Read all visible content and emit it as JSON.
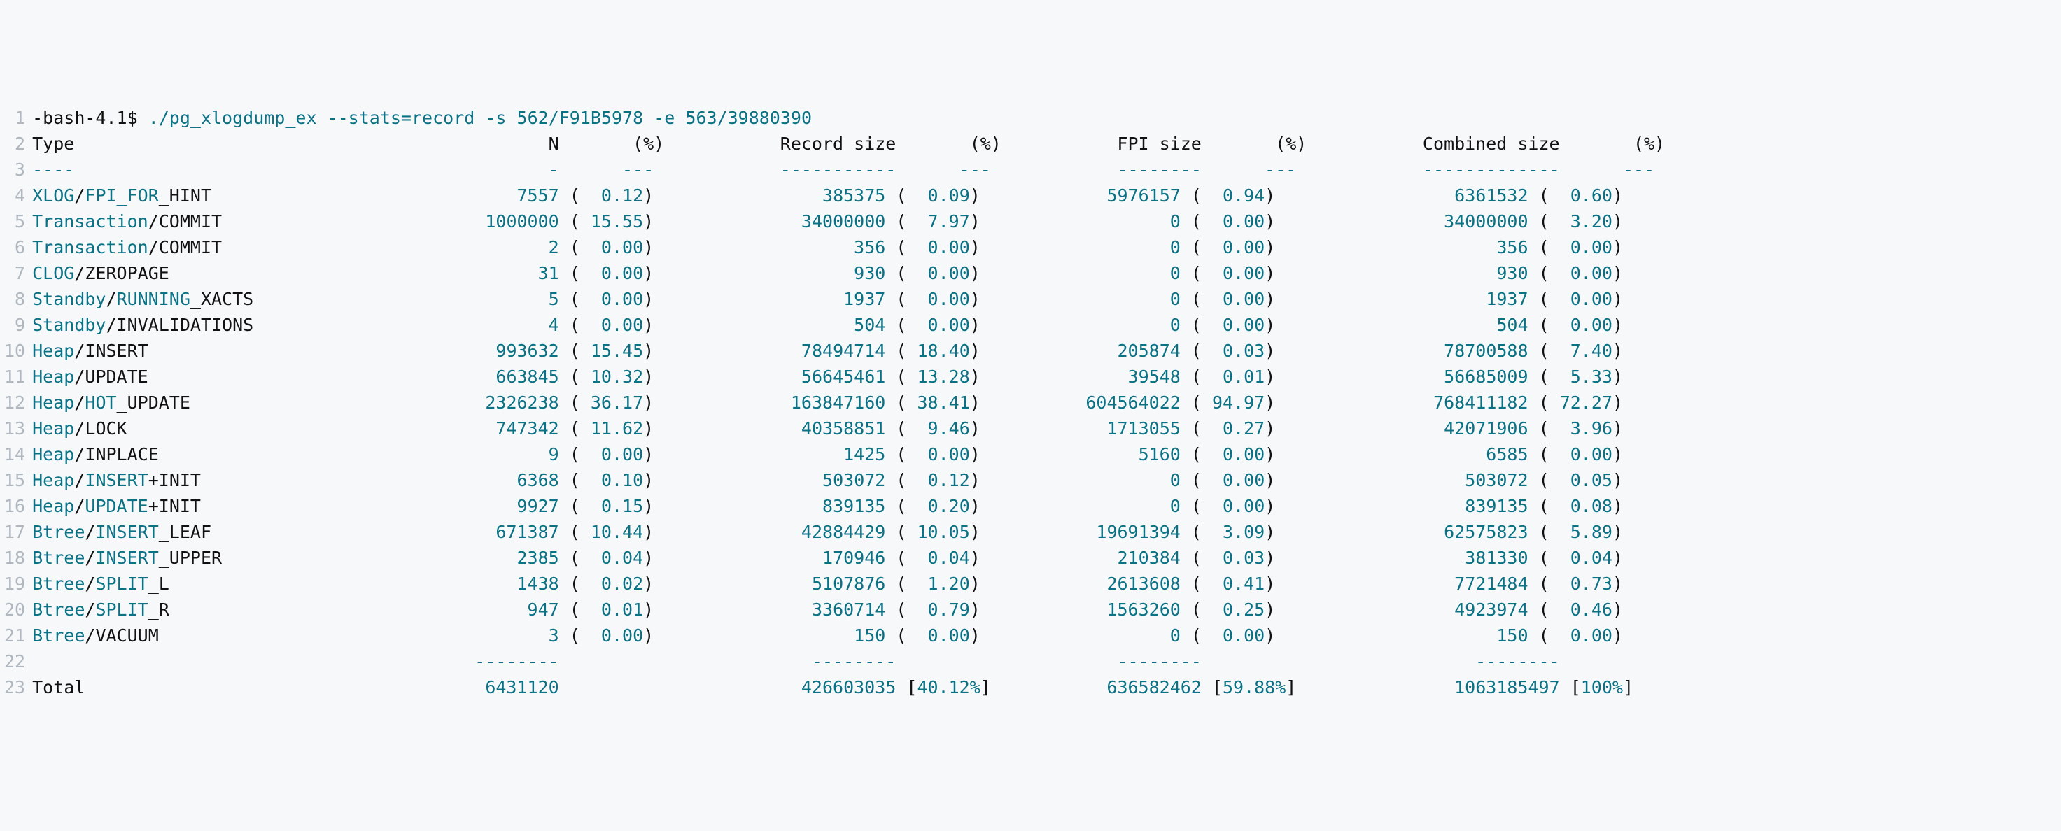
{
  "prompt": "-bash-4.1$ ",
  "cmd": {
    "exe": "./pg_xlogdump_ex",
    "flag_stats": "--stats=record",
    "flag_s": "-s",
    "val_s": "562/F91B5978",
    "flag_e": "-e",
    "val_e": "563/39880390"
  },
  "header": {
    "type": "Type",
    "n": "N",
    "np": "(%)",
    "rs": "Record size",
    "rsp": "(%)",
    "fs": "FPI size",
    "fsp": "(%)",
    "cs": "Combined size",
    "csp": "(%)"
  },
  "sep": {
    "type": "----",
    "n": "-",
    "np": "---",
    "rs": "-----------",
    "rsp": "---",
    "fs": "--------",
    "fsp": "---",
    "cs": "-------------",
    "csp": "---"
  },
  "rows": [
    {
      "a": "XLOG",
      "s": "/",
      "b": "FPI_FOR",
      "c": "_HINT",
      "n": "7557",
      "np": "0.12",
      "rs": "385375",
      "rsp": "0.09",
      "fs": "5976157",
      "fsp": "0.94",
      "cs": "6361532",
      "csp": "0.60"
    },
    {
      "a": "Transaction",
      "s": "/",
      "b": "",
      "c": "COMMIT",
      "n": "1000000",
      "np": "15.55",
      "rs": "34000000",
      "rsp": "7.97",
      "fs": "0",
      "fsp": "0.00",
      "cs": "34000000",
      "csp": "3.20"
    },
    {
      "a": "Transaction",
      "s": "/",
      "b": "",
      "c": "COMMIT",
      "n": "2",
      "np": "0.00",
      "rs": "356",
      "rsp": "0.00",
      "fs": "0",
      "fsp": "0.00",
      "cs": "356",
      "csp": "0.00"
    },
    {
      "a": "CLOG",
      "s": "/",
      "b": "",
      "c": "ZEROPAGE",
      "n": "31",
      "np": "0.00",
      "rs": "930",
      "rsp": "0.00",
      "fs": "0",
      "fsp": "0.00",
      "cs": "930",
      "csp": "0.00"
    },
    {
      "a": "Standby",
      "s": "/",
      "b": "RUNNING",
      "c": "_XACTS",
      "n": "5",
      "np": "0.00",
      "rs": "1937",
      "rsp": "0.00",
      "fs": "0",
      "fsp": "0.00",
      "cs": "1937",
      "csp": "0.00"
    },
    {
      "a": "Standby",
      "s": "/",
      "b": "",
      "c": "INVALIDATIONS",
      "n": "4",
      "np": "0.00",
      "rs": "504",
      "rsp": "0.00",
      "fs": "0",
      "fsp": "0.00",
      "cs": "504",
      "csp": "0.00"
    },
    {
      "a": "Heap",
      "s": "/",
      "b": "",
      "c": "INSERT",
      "n": "993632",
      "np": "15.45",
      "rs": "78494714",
      "rsp": "18.40",
      "fs": "205874",
      "fsp": "0.03",
      "cs": "78700588",
      "csp": "7.40"
    },
    {
      "a": "Heap",
      "s": "/",
      "b": "",
      "c": "UPDATE",
      "n": "663845",
      "np": "10.32",
      "rs": "56645461",
      "rsp": "13.28",
      "fs": "39548",
      "fsp": "0.01",
      "cs": "56685009",
      "csp": "5.33"
    },
    {
      "a": "Heap",
      "s": "/",
      "b": "HOT",
      "c": "_UPDATE",
      "n": "2326238",
      "np": "36.17",
      "rs": "163847160",
      "rsp": "38.41",
      "fs": "604564022",
      "fsp": "94.97",
      "cs": "768411182",
      "csp": "72.27"
    },
    {
      "a": "Heap",
      "s": "/",
      "b": "",
      "c": "LOCK",
      "n": "747342",
      "np": "11.62",
      "rs": "40358851",
      "rsp": "9.46",
      "fs": "1713055",
      "fsp": "0.27",
      "cs": "42071906",
      "csp": "3.96"
    },
    {
      "a": "Heap",
      "s": "/",
      "b": "",
      "c": "INPLACE",
      "n": "9",
      "np": "0.00",
      "rs": "1425",
      "rsp": "0.00",
      "fs": "5160",
      "fsp": "0.00",
      "cs": "6585",
      "csp": "0.00"
    },
    {
      "a": "Heap",
      "s": "/",
      "b": "INSERT",
      "s2": "+",
      "c": "INIT",
      "n": "6368",
      "np": "0.10",
      "rs": "503072",
      "rsp": "0.12",
      "fs": "0",
      "fsp": "0.00",
      "cs": "503072",
      "csp": "0.05"
    },
    {
      "a": "Heap",
      "s": "/",
      "b": "UPDATE",
      "s2": "+",
      "c": "INIT",
      "n": "9927",
      "np": "0.15",
      "rs": "839135",
      "rsp": "0.20",
      "fs": "0",
      "fsp": "0.00",
      "cs": "839135",
      "csp": "0.08"
    },
    {
      "a": "Btree",
      "s": "/",
      "b": "INSERT",
      "c": "_LEAF",
      "n": "671387",
      "np": "10.44",
      "rs": "42884429",
      "rsp": "10.05",
      "fs": "19691394",
      "fsp": "3.09",
      "cs": "62575823",
      "csp": "5.89"
    },
    {
      "a": "Btree",
      "s": "/",
      "b": "INSERT",
      "c": "_UPPER",
      "n": "2385",
      "np": "0.04",
      "rs": "170946",
      "rsp": "0.04",
      "fs": "210384",
      "fsp": "0.03",
      "cs": "381330",
      "csp": "0.04"
    },
    {
      "a": "Btree",
      "s": "/",
      "b": "SPLIT",
      "c": "_L",
      "n": "1438",
      "np": "0.02",
      "rs": "5107876",
      "rsp": "1.20",
      "fs": "2613608",
      "fsp": "0.41",
      "cs": "7721484",
      "csp": "0.73"
    },
    {
      "a": "Btree",
      "s": "/",
      "b": "SPLIT",
      "c": "_R",
      "n": "947",
      "np": "0.01",
      "rs": "3360714",
      "rsp": "0.79",
      "fs": "1563260",
      "fsp": "0.25",
      "cs": "4923974",
      "csp": "0.46"
    },
    {
      "a": "Btree",
      "s": "/",
      "b": "",
      "c": "VACUUM",
      "n": "3",
      "np": "0.00",
      "rs": "150",
      "rsp": "0.00",
      "fs": "0",
      "fsp": "0.00",
      "cs": "150",
      "csp": "0.00"
    }
  ],
  "totsep": "--------",
  "total": {
    "label": "Total",
    "n": "6431120",
    "rs": "426603035",
    "rsp": "40.12%",
    "fs": "636582462",
    "fsp": "59.88%",
    "cs": "1063185497",
    "csp": "100%"
  },
  "chart_data": {
    "type": "table",
    "title": "pg_xlogdump_ex --stats=record",
    "columns": [
      "Type",
      "N",
      "N_%",
      "Record size",
      "Record_%",
      "FPI size",
      "FPI_%",
      "Combined size",
      "Combined_%"
    ],
    "rows": [
      [
        "XLOG/FPI_FOR_HINT",
        7557,
        0.12,
        385375,
        0.09,
        5976157,
        0.94,
        6361532,
        0.6
      ],
      [
        "Transaction/COMMIT",
        1000000,
        15.55,
        34000000,
        7.97,
        0,
        0.0,
        34000000,
        3.2
      ],
      [
        "Transaction/COMMIT",
        2,
        0.0,
        356,
        0.0,
        0,
        0.0,
        356,
        0.0
      ],
      [
        "CLOG/ZEROPAGE",
        31,
        0.0,
        930,
        0.0,
        0,
        0.0,
        930,
        0.0
      ],
      [
        "Standby/RUNNING_XACTS",
        5,
        0.0,
        1937,
        0.0,
        0,
        0.0,
        1937,
        0.0
      ],
      [
        "Standby/INVALIDATIONS",
        4,
        0.0,
        504,
        0.0,
        0,
        0.0,
        504,
        0.0
      ],
      [
        "Heap/INSERT",
        993632,
        15.45,
        78494714,
        18.4,
        205874,
        0.03,
        78700588,
        7.4
      ],
      [
        "Heap/UPDATE",
        663845,
        10.32,
        56645461,
        13.28,
        39548,
        0.01,
        56685009,
        5.33
      ],
      [
        "Heap/HOT_UPDATE",
        2326238,
        36.17,
        163847160,
        38.41,
        604564022,
        94.97,
        768411182,
        72.27
      ],
      [
        "Heap/LOCK",
        747342,
        11.62,
        40358851,
        9.46,
        1713055,
        0.27,
        42071906,
        3.96
      ],
      [
        "Heap/INPLACE",
        9,
        0.0,
        1425,
        0.0,
        5160,
        0.0,
        6585,
        0.0
      ],
      [
        "Heap/INSERT+INIT",
        6368,
        0.1,
        503072,
        0.12,
        0,
        0.0,
        503072,
        0.05
      ],
      [
        "Heap/UPDATE+INIT",
        9927,
        0.15,
        839135,
        0.2,
        0,
        0.0,
        839135,
        0.08
      ],
      [
        "Btree/INSERT_LEAF",
        671387,
        10.44,
        42884429,
        10.05,
        19691394,
        3.09,
        62575823,
        5.89
      ],
      [
        "Btree/INSERT_UPPER",
        2385,
        0.04,
        170946,
        0.04,
        210384,
        0.03,
        381330,
        0.04
      ],
      [
        "Btree/SPLIT_L",
        1438,
        0.02,
        5107876,
        1.2,
        2613608,
        0.41,
        7721484,
        0.73
      ],
      [
        "Btree/SPLIT_R",
        947,
        0.01,
        3360714,
        0.79,
        1563260,
        0.25,
        4923974,
        0.46
      ],
      [
        "Btree/VACUUM",
        3,
        0.0,
        150,
        0.0,
        0,
        0.0,
        150,
        0.0
      ]
    ],
    "totals": {
      "N": 6431120,
      "Record size": 426603035,
      "Record_%": 40.12,
      "FPI size": 636582462,
      "FPI_%": 59.88,
      "Combined size": 1063185497,
      "Combined_%": 100
    }
  }
}
